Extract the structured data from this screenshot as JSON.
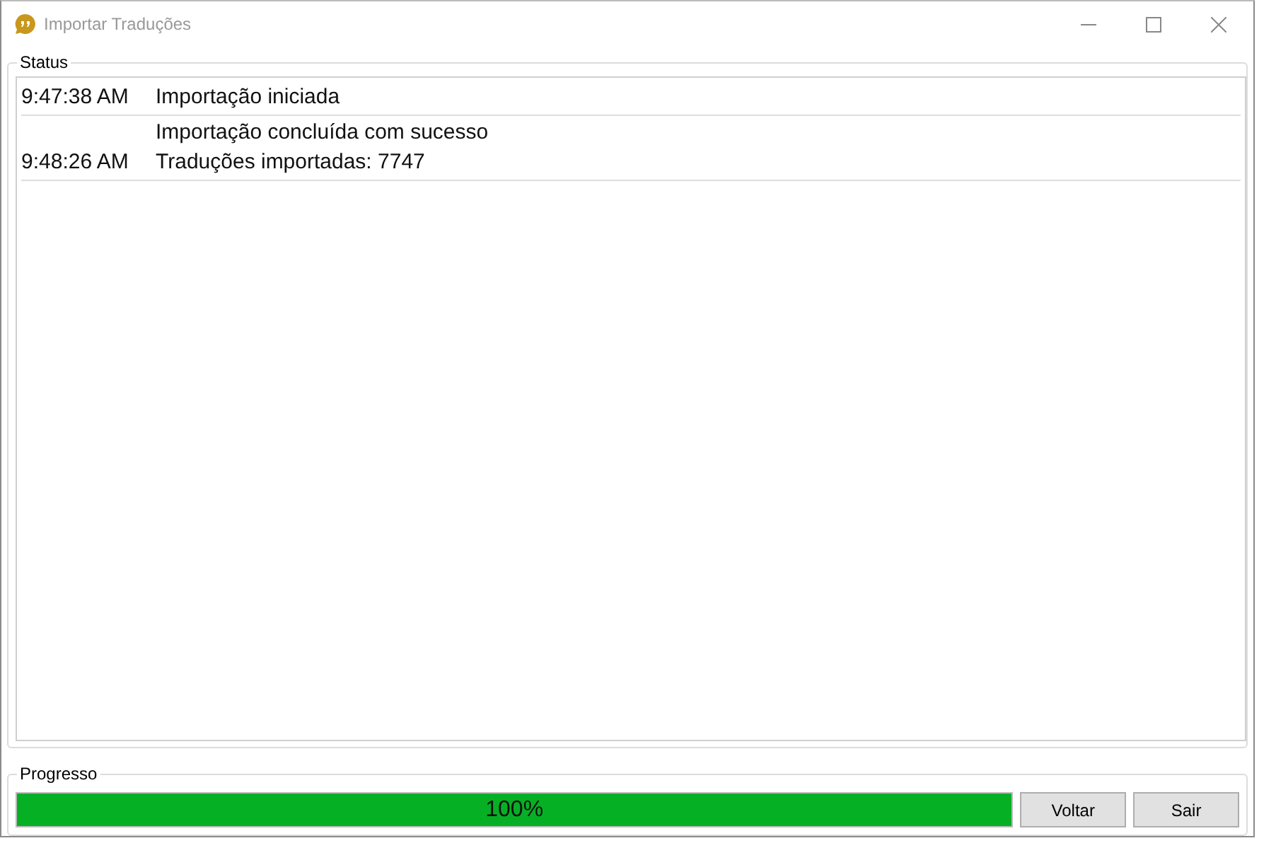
{
  "window": {
    "title": "Importar Traduções"
  },
  "status": {
    "label": "Status",
    "entries": [
      {
        "time": "9:47:38 AM",
        "lines": [
          "Importação iniciada"
        ]
      },
      {
        "time": "9:48:26 AM",
        "lines": [
          "Importação concluída com sucesso",
          "Traduções importadas: 7747"
        ]
      }
    ]
  },
  "progress": {
    "label": "Progresso",
    "level": 1,
    "reading": "100%"
  },
  "buttons": [
    "Voltar",
    "Sair"
  ]
}
